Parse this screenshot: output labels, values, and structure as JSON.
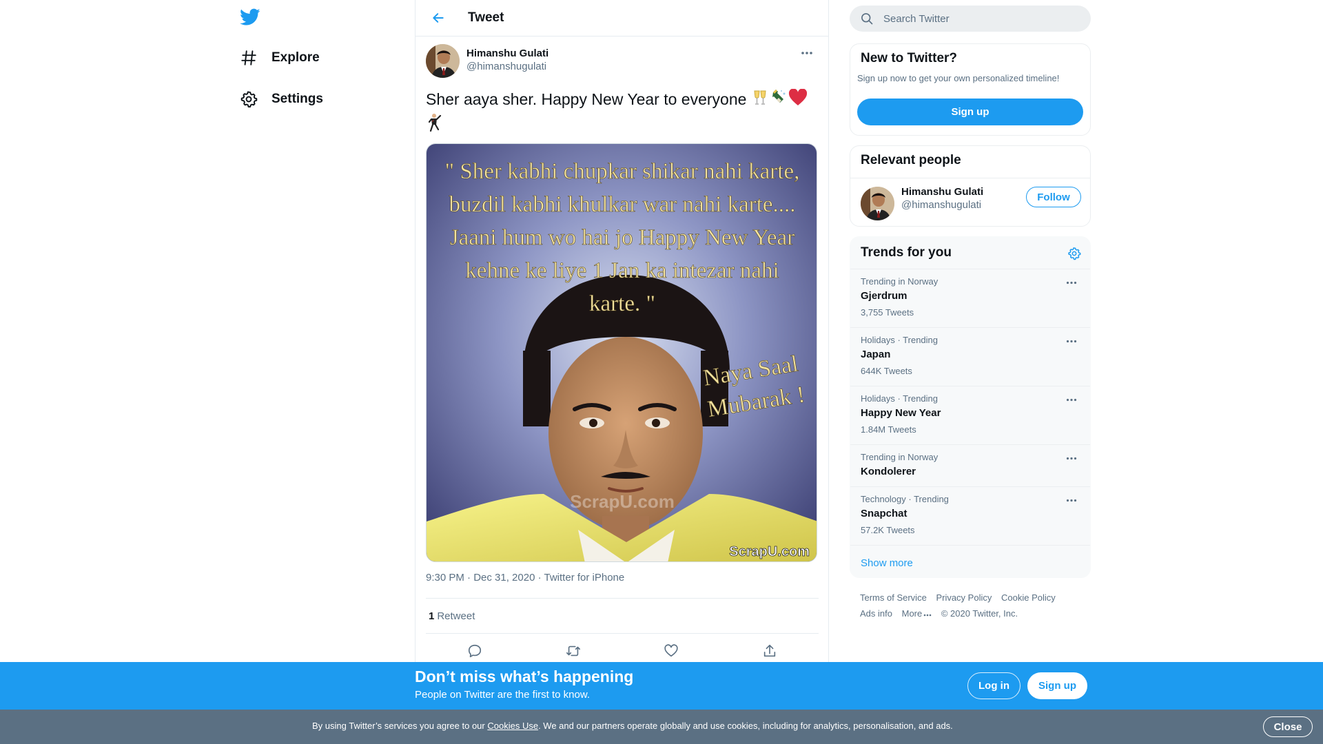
{
  "colors": {
    "accent": "#1d9bf0",
    "text": "#0f1419",
    "secondary": "#5b7083",
    "cookie_bar": "#5b7083"
  },
  "nav": {
    "logo_icon": "twitter-bird-icon",
    "items": [
      {
        "label": "Explore",
        "icon": "hashtag-icon"
      },
      {
        "label": "Settings",
        "icon": "gear-icon"
      }
    ]
  },
  "header": {
    "title": "Tweet",
    "back_icon": "arrow-left-icon"
  },
  "tweet": {
    "author_name": "Himanshu Gulati",
    "author_handle": "@himanshugulati",
    "text": "Sher aaya sher. Happy New Year to everyone",
    "emojis": [
      "clinking-glasses",
      "champagne-bottle",
      "red-heart",
      "dancing-man"
    ],
    "image_text": {
      "quote_line1": "\" Sher kabhi chupkar shikar nahi karte,",
      "quote_line2": "buzdil kabhi khulkar war nahi karte....",
      "quote_line3": "Jaani hum wo hai jo Happy New Year",
      "quote_line4": "kehne ke liye 1 Jan ka intezar nahi",
      "quote_line5": "karte. \"",
      "greeting_line1": "Naya Saal",
      "greeting_line2": "Mubarak !",
      "watermark": "ScrapU.com",
      "corner_logo": "ScrapU.com"
    },
    "time": "9:30 PM · Dec 31, 2020",
    "source": "Twitter for iPhone",
    "retweet_count": "1",
    "retweet_label": "Retweet"
  },
  "search": {
    "placeholder": "Search Twitter"
  },
  "new_to_twitter": {
    "title": "New to Twitter?",
    "subtitle": "Sign up now to get your own personalized timeline!",
    "signup_label": "Sign up"
  },
  "relevant_people": {
    "title": "Relevant people",
    "name": "Himanshu Gulati",
    "handle": "@himanshugulati",
    "follow_label": "Follow"
  },
  "trends": {
    "title": "Trends for you",
    "items": [
      {
        "context": "Trending in Norway",
        "name": "Gjerdrum",
        "count": "3,755 Tweets"
      },
      {
        "context": "Holidays · Trending",
        "name": "Japan",
        "count": "644K Tweets"
      },
      {
        "context": "Holidays · Trending",
        "name": "Happy New Year",
        "count": "1.84M Tweets"
      },
      {
        "context": "Trending in Norway",
        "name": "Kondolerer",
        "count": ""
      },
      {
        "context": "Technology · Trending",
        "name": "Snapchat",
        "count": "57.2K Tweets"
      }
    ],
    "show_more": "Show more"
  },
  "footer": {
    "links": [
      "Terms of Service",
      "Privacy Policy",
      "Cookie Policy",
      "Ads info",
      "More"
    ],
    "copyright": "© 2020 Twitter, Inc."
  },
  "banner": {
    "title": "Don’t miss what’s happening",
    "subtitle": "People on Twitter are the first to know.",
    "login_label": "Log in",
    "signup_label": "Sign up"
  },
  "cookie": {
    "text_before": "By using Twitter’s services you agree to our ",
    "link": "Cookies Use",
    "text_after": ". We and our partners operate globally and use cookies, including for analytics, personalisation, and ads.",
    "close_label": "Close"
  }
}
